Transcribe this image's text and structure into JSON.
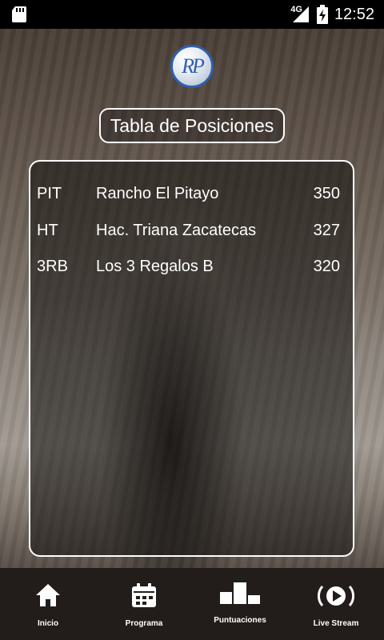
{
  "status_bar": {
    "network": "4G",
    "time": "12:52"
  },
  "logo_text": "RP",
  "title": "Tabla de Posiciones",
  "standings": [
    {
      "code": "PIT",
      "name": "Rancho El Pitayo",
      "score": "350"
    },
    {
      "code": "HT",
      "name": "Hac. Triana Zacatecas",
      "score": "327"
    },
    {
      "code": "3RB",
      "name": "Los 3 Regalos B",
      "score": "320"
    }
  ],
  "nav": [
    {
      "label": "Inicio",
      "icon": "home-icon"
    },
    {
      "label": "Programa",
      "icon": "calendar-icon"
    },
    {
      "label": "Puntuaciones",
      "icon": "podium-icon"
    },
    {
      "label": "Live Stream",
      "icon": "play-icon"
    }
  ]
}
